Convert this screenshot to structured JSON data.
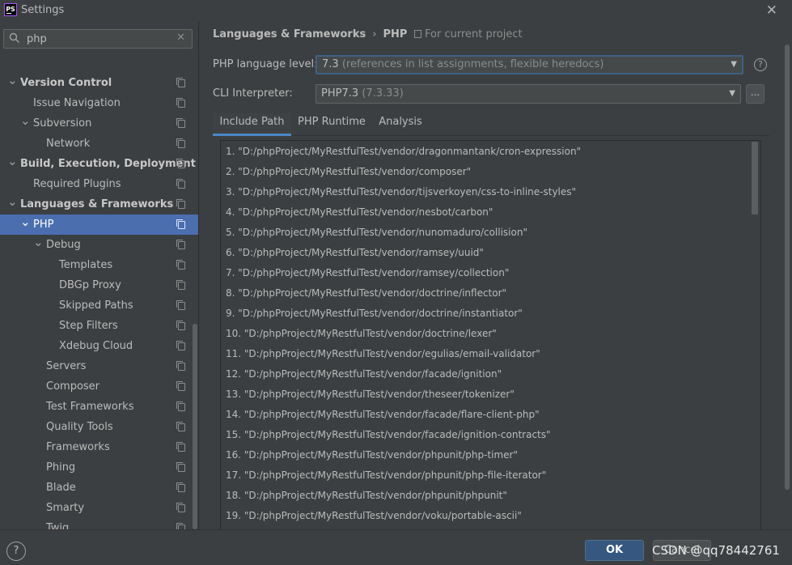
{
  "window": {
    "title": "Settings",
    "app_icon_text": "PS",
    "close_glyph": "✕"
  },
  "search": {
    "value": "php"
  },
  "tree": [
    {
      "label": "Version Control",
      "level": 0,
      "expanded": true,
      "bold": true,
      "selected": false
    },
    {
      "label": "Issue Navigation",
      "level": 1,
      "expanded": null,
      "bold": false,
      "selected": false
    },
    {
      "label": "Subversion",
      "level": 1,
      "expanded": true,
      "bold": false,
      "selected": false
    },
    {
      "label": "Network",
      "level": 2,
      "expanded": null,
      "bold": false,
      "selected": false
    },
    {
      "label": "Build, Execution, Deployment",
      "level": 0,
      "expanded": true,
      "bold": true,
      "selected": false
    },
    {
      "label": "Required Plugins",
      "level": 1,
      "expanded": null,
      "bold": false,
      "selected": false
    },
    {
      "label": "Languages & Frameworks",
      "level": 0,
      "expanded": true,
      "bold": true,
      "selected": false
    },
    {
      "label": "PHP",
      "level": 1,
      "expanded": true,
      "bold": false,
      "selected": true
    },
    {
      "label": "Debug",
      "level": 2,
      "expanded": true,
      "bold": false,
      "selected": false
    },
    {
      "label": "Templates",
      "level": 3,
      "expanded": null,
      "bold": false,
      "selected": false
    },
    {
      "label": "DBGp Proxy",
      "level": 3,
      "expanded": null,
      "bold": false,
      "selected": false
    },
    {
      "label": "Skipped Paths",
      "level": 3,
      "expanded": null,
      "bold": false,
      "selected": false
    },
    {
      "label": "Step Filters",
      "level": 3,
      "expanded": null,
      "bold": false,
      "selected": false
    },
    {
      "label": "Xdebug Cloud",
      "level": 3,
      "expanded": null,
      "bold": false,
      "selected": false
    },
    {
      "label": "Servers",
      "level": 2,
      "expanded": null,
      "bold": false,
      "selected": false
    },
    {
      "label": "Composer",
      "level": 2,
      "expanded": null,
      "bold": false,
      "selected": false
    },
    {
      "label": "Test Frameworks",
      "level": 2,
      "expanded": null,
      "bold": false,
      "selected": false
    },
    {
      "label": "Quality Tools",
      "level": 2,
      "expanded": null,
      "bold": false,
      "selected": false
    },
    {
      "label": "Frameworks",
      "level": 2,
      "expanded": null,
      "bold": false,
      "selected": false
    },
    {
      "label": "Phing",
      "level": 2,
      "expanded": null,
      "bold": false,
      "selected": false
    },
    {
      "label": "Blade",
      "level": 2,
      "expanded": null,
      "bold": false,
      "selected": false
    },
    {
      "label": "Smarty",
      "level": 2,
      "expanded": null,
      "bold": false,
      "selected": false
    },
    {
      "label": "Twig",
      "level": 2,
      "expanded": null,
      "bold": false,
      "selected": false
    }
  ],
  "breadcrumb": {
    "parent": "Languages & Frameworks",
    "separator": "›",
    "current": "PHP",
    "scope": "For current project"
  },
  "language_level": {
    "label": "PHP language level:",
    "value": "7.3",
    "detail": "(references in list assignments, flexible heredocs)"
  },
  "cli_interpreter": {
    "label": "CLI Interpreter:",
    "value": "PHP7.3",
    "detail": "(7.3.33)",
    "browse_label": "..."
  },
  "help_glyph": "?",
  "tabs": [
    "Include Path",
    "PHP Runtime",
    "Analysis"
  ],
  "active_tab": "Include Path",
  "include_paths": [
    "1. \"D:/phpProject/MyRestfulTest/vendor/dragonmantank/cron-expression\"",
    "2. \"D:/phpProject/MyRestfulTest/vendor/composer\"",
    "3. \"D:/phpProject/MyRestfulTest/vendor/tijsverkoyen/css-to-inline-styles\"",
    "4. \"D:/phpProject/MyRestfulTest/vendor/nesbot/carbon\"",
    "5. \"D:/phpProject/MyRestfulTest/vendor/nunomaduro/collision\"",
    "6. \"D:/phpProject/MyRestfulTest/vendor/ramsey/uuid\"",
    "7. \"D:/phpProject/MyRestfulTest/vendor/ramsey/collection\"",
    "8. \"D:/phpProject/MyRestfulTest/vendor/doctrine/inflector\"",
    "9. \"D:/phpProject/MyRestfulTest/vendor/doctrine/instantiator\"",
    "10. \"D:/phpProject/MyRestfulTest/vendor/doctrine/lexer\"",
    "11. \"D:/phpProject/MyRestfulTest/vendor/egulias/email-validator\"",
    "12. \"D:/phpProject/MyRestfulTest/vendor/facade/ignition\"",
    "13. \"D:/phpProject/MyRestfulTest/vendor/theseer/tokenizer\"",
    "14. \"D:/phpProject/MyRestfulTest/vendor/facade/flare-client-php\"",
    "15. \"D:/phpProject/MyRestfulTest/vendor/facade/ignition-contracts\"",
    "16. \"D:/phpProject/MyRestfulTest/vendor/phpunit/php-timer\"",
    "17. \"D:/phpProject/MyRestfulTest/vendor/phpunit/php-file-iterator\"",
    "18. \"D:/phpProject/MyRestfulTest/vendor/phpunit/phpunit\"",
    "19. \"D:/phpProject/MyRestfulTest/vendor/voku/portable-ascii\""
  ],
  "footer": {
    "help_glyph": "?",
    "ok_label": "OK",
    "cancel_label": "Cancel",
    "watermark": "CSDN @qq78442761"
  },
  "colors": {
    "background": "#3c3f41",
    "selection": "#4b6eaf",
    "accent": "#4a88c7",
    "ok_button": "#365880"
  }
}
